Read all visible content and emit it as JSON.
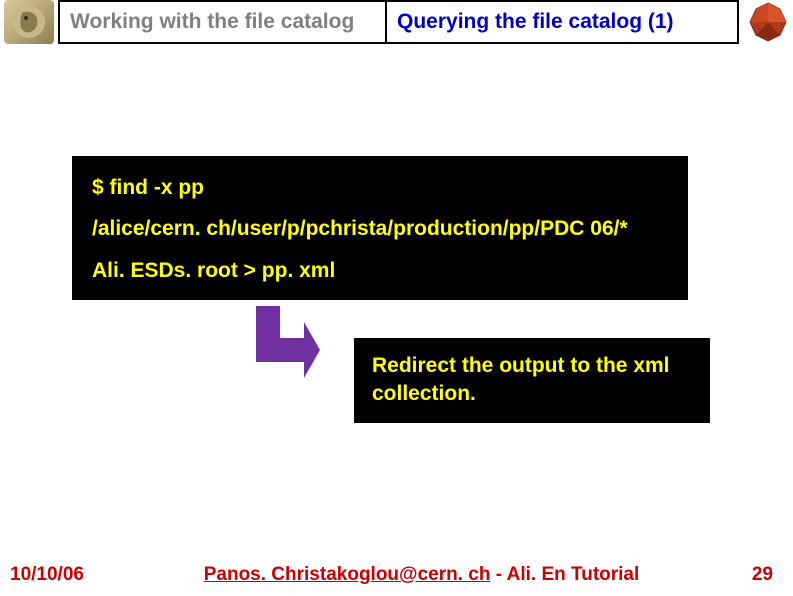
{
  "header": {
    "left_title": "Working with the file catalog",
    "right_title": "Querying the file catalog (1)"
  },
  "code": {
    "line1": "$ find -x pp",
    "line2": "/alice/cern. ch/user/p/pchrista/production/pp/PDC 06/*",
    "line3": "Ali. ESDs. root > pp. xml"
  },
  "tip": {
    "text": "Redirect the output to the xml collection."
  },
  "footer": {
    "date": "10/10/06",
    "email": "Panos. Christakoglou@cern. ch",
    "suffix": " - Ali. En Tutorial",
    "page": "29"
  }
}
